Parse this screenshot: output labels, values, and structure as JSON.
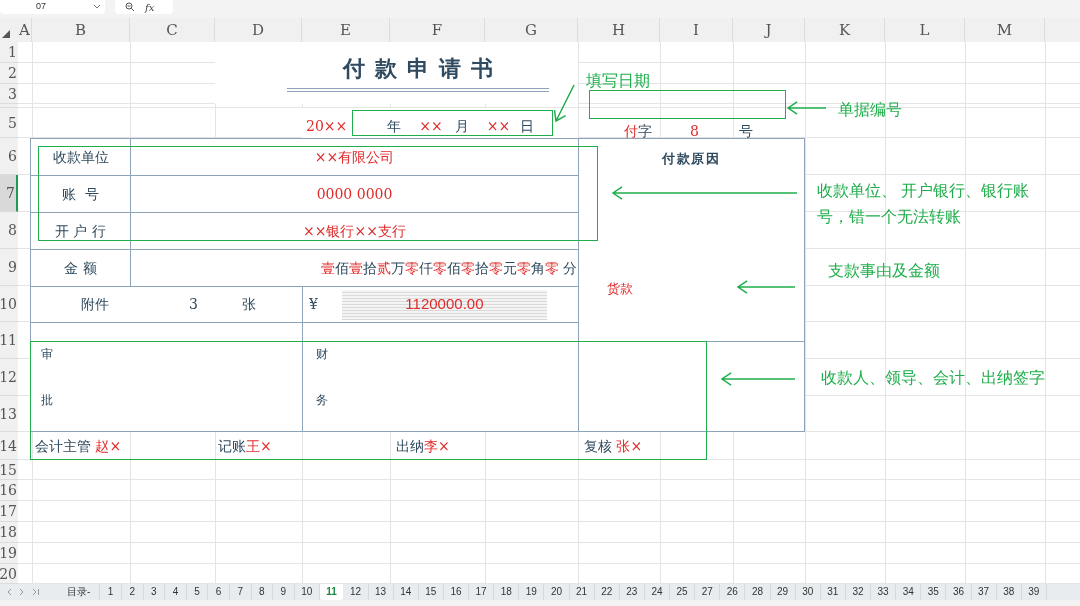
{
  "formula_bar": {
    "cell_name": "07",
    "function_label": "fx"
  },
  "column_headers": [
    "A",
    "B",
    "C",
    "D",
    "E",
    "F",
    "G",
    "H",
    "I",
    "J",
    "K",
    "L",
    "M"
  ],
  "row_headers": [
    {
      "label": "1",
      "selected": false
    },
    {
      "label": "2",
      "selected": false
    },
    {
      "label": "3",
      "selected": false
    },
    {
      "label": "5",
      "selected": false
    },
    {
      "label": "6",
      "selected": false
    },
    {
      "label": "7",
      "selected": true
    },
    {
      "label": "8",
      "selected": false
    },
    {
      "label": "9",
      "selected": false
    },
    {
      "label": "10",
      "selected": false
    },
    {
      "label": "11",
      "selected": false
    },
    {
      "label": "12",
      "selected": false
    },
    {
      "label": "13",
      "selected": false
    },
    {
      "label": "14",
      "selected": false
    },
    {
      "label": "15",
      "selected": false
    },
    {
      "label": "16",
      "selected": false
    },
    {
      "label": "17",
      "selected": false
    },
    {
      "label": "18",
      "selected": false
    },
    {
      "label": "19",
      "selected": false
    },
    {
      "label": "20",
      "selected": false
    }
  ],
  "form": {
    "title": "付款申请书",
    "date": [
      {
        "text": "20××",
        "filled": true
      },
      {
        "text": "年",
        "filled": false
      },
      {
        "text": "××",
        "filled": true
      },
      {
        "text": "月",
        "filled": false
      },
      {
        "text": "××",
        "filled": true
      },
      {
        "text": "日",
        "filled": false
      }
    ],
    "voucher": [
      {
        "parts": [
          {
            "text": "付",
            "filled": true
          },
          {
            "text": "字",
            "filled": false
          }
        ]
      },
      {
        "parts": [
          {
            "text": "8",
            "filled": true
          }
        ]
      },
      {
        "parts": [
          {
            "text": "号",
            "filled": false
          }
        ]
      }
    ],
    "payee_rows": [
      {
        "label": "收款单位",
        "value": "××有限公司"
      },
      {
        "label": "账  号",
        "value": "0000 0000"
      },
      {
        "label": "开 户 行",
        "value": "××银行××支行"
      }
    ],
    "amount_label": "金 额",
    "amount_words": [
      {
        "text": "壹",
        "filled": true
      },
      {
        "text": "佰",
        "filled": false
      },
      {
        "text": "壹",
        "filled": true
      },
      {
        "text": "拾",
        "filled": false
      },
      {
        "text": "贰",
        "filled": true
      },
      {
        "text": "万",
        "filled": false
      },
      {
        "text": "零",
        "filled": true
      },
      {
        "text": "仟",
        "filled": false
      },
      {
        "text": "零",
        "filled": true
      },
      {
        "text": "佰",
        "filled": false
      },
      {
        "text": "零",
        "filled": true
      },
      {
        "text": "拾",
        "filled": false
      },
      {
        "text": "零",
        "filled": true
      },
      {
        "text": "元",
        "filled": false
      },
      {
        "text": "零",
        "filled": true
      },
      {
        "text": "角",
        "filled": false
      },
      {
        "text": "零",
        "filled": true
      },
      {
        "text": " 分",
        "filled": false
      }
    ],
    "attachment_label": "附件",
    "attachment_count": "3",
    "attachment_unit": "张",
    "currency": "¥",
    "amount": "1120000.00",
    "reason_label": "付款原因",
    "reason": "货款",
    "approval": [
      "审",
      "批"
    ],
    "finance": [
      "财",
      "务"
    ],
    "signatures": [
      {
        "role": "会计主管 ",
        "name": "赵×"
      },
      {
        "role": "记账",
        "name": "王×"
      },
      {
        "role": "出纳",
        "name": "李×"
      },
      {
        "role": "复核 ",
        "name": "张×"
      }
    ]
  },
  "annotations": [
    {
      "kind": "date",
      "text": "填写日期"
    },
    {
      "kind": "voucher",
      "text": "单据编号"
    },
    {
      "kind": "payee",
      "text": "收款单位、 开户银行、银行账号，错一个无法转账"
    },
    {
      "kind": "reason",
      "text": "支款事由及金额"
    },
    {
      "kind": "signature",
      "text": "收款人、领导、会计、出纳签字"
    }
  ],
  "sheet_tabs": [
    {
      "label": "目录-",
      "selected": false
    },
    {
      "label": "1",
      "selected": false
    },
    {
      "label": "2",
      "selected": false
    },
    {
      "label": "3",
      "selected": false
    },
    {
      "label": "4",
      "selected": false
    },
    {
      "label": "5",
      "selected": false
    },
    {
      "label": "6",
      "selected": false
    },
    {
      "label": "7",
      "selected": false
    },
    {
      "label": "8",
      "selected": false
    },
    {
      "label": "9",
      "selected": false
    },
    {
      "label": "10",
      "selected": false
    },
    {
      "label": "11",
      "selected": true
    },
    {
      "label": "12",
      "selected": false
    },
    {
      "label": "13",
      "selected": false
    },
    {
      "label": "14",
      "selected": false
    },
    {
      "label": "15",
      "selected": false
    },
    {
      "label": "16",
      "selected": false
    },
    {
      "label": "17",
      "selected": false
    },
    {
      "label": "18",
      "selected": false
    },
    {
      "label": "19",
      "selected": false
    },
    {
      "label": "20",
      "selected": false
    },
    {
      "label": "21",
      "selected": false
    },
    {
      "label": "22",
      "selected": false
    },
    {
      "label": "23",
      "selected": false
    },
    {
      "label": "24",
      "selected": false
    },
    {
      "label": "25",
      "selected": false
    },
    {
      "label": "27",
      "selected": false
    },
    {
      "label": "26",
      "selected": false
    },
    {
      "label": "28",
      "selected": false
    },
    {
      "label": "29",
      "selected": false
    },
    {
      "label": "30",
      "selected": false
    },
    {
      "label": "31",
      "selected": false
    },
    {
      "label": "32",
      "selected": false
    },
    {
      "label": "33",
      "selected": false
    },
    {
      "label": "34",
      "selected": false
    },
    {
      "label": "35",
      "selected": false
    },
    {
      "label": "36",
      "selected": false
    },
    {
      "label": "37",
      "selected": false
    },
    {
      "label": "38",
      "selected": false
    },
    {
      "label": "39",
      "selected": false
    }
  ]
}
